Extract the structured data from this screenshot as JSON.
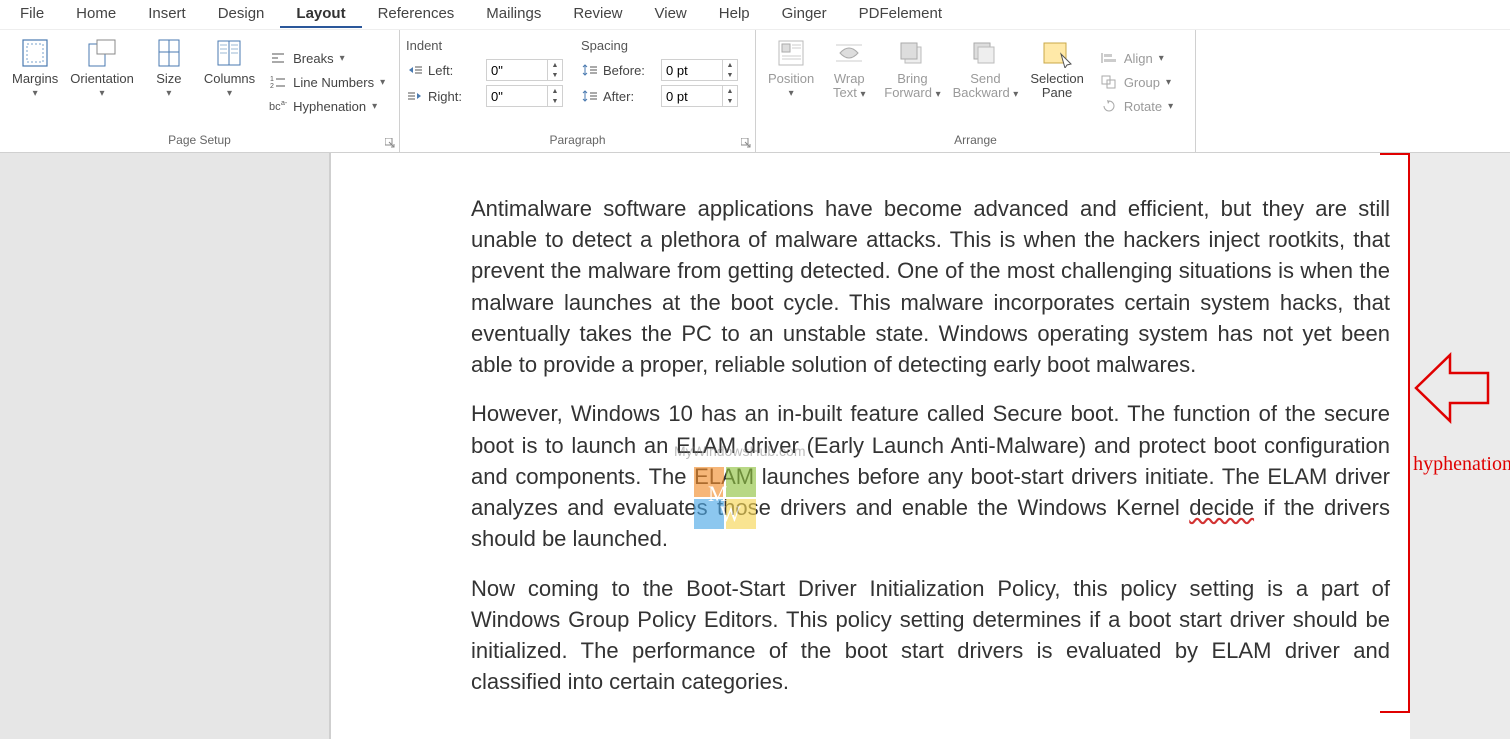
{
  "tabs": [
    "File",
    "Home",
    "Insert",
    "Design",
    "Layout",
    "References",
    "Mailings",
    "Review",
    "View",
    "Help",
    "Ginger",
    "PDFelement"
  ],
  "active_tab": "Layout",
  "page_setup": {
    "label": "Page Setup",
    "margins": "Margins",
    "orientation": "Orientation",
    "size": "Size",
    "columns": "Columns",
    "breaks": "Breaks",
    "line_numbers": "Line Numbers",
    "hyphenation": "Hyphenation"
  },
  "paragraph": {
    "label": "Paragraph",
    "indent_head": "Indent",
    "spacing_head": "Spacing",
    "left_label": "Left:",
    "right_label": "Right:",
    "before_label": "Before:",
    "after_label": "After:",
    "left_value": "0\"",
    "right_value": "0\"",
    "before_value": "0 pt",
    "after_value": "0 pt"
  },
  "arrange": {
    "label": "Arrange",
    "position": "Position",
    "wrap_text_l1": "Wrap",
    "wrap_text_l2": "Text",
    "bring_l1": "Bring",
    "bring_l2": "Forward",
    "send_l1": "Send",
    "send_l2": "Backward",
    "selection_l1": "Selection",
    "selection_l2": "Pane",
    "align": "Align",
    "group": "Group",
    "rotate": "Rotate"
  },
  "document": {
    "para1": "Antimalware software applications have become advanced and efficient, but they are still unable to detect a plethora of malware attacks. This is when the hackers inject rootkits, that prevent the malware from getting detected. One of the most challenging situations is when the malware launches at the boot cycle. This malware incorporates certain system hacks, that eventually takes the PC to an unstable state. Windows oper­ating system has not yet been able to provide a proper, reliable solution of detecting early boot malwares.",
    "para2a": "However, Windows 10 has an in-built feature called Secure boot. The function of the se­cure boot is to launch an ELAM driver (Early Launch Anti-Malware) and protect boot configuration and components. The ELAM launches before any boot-start drivers initi­ate. The ELAM driver analyzes and evaluates those drivers and enable the Windows Kernel ",
    "para2_decide": "decide",
    "para2b": " if the drivers should be launched.",
    "para3": "Now coming to the Boot-Start Driver Initialization Policy, this policy setting is a part of Windows Group Policy Editors. This policy setting determines if a boot start driver should be initialized.  The performance of the boot start drivers is evaluated by ELAM driver and classified into certain categories."
  },
  "watermark": "MyWindowsHub.com",
  "annotation_label": "hyphenation"
}
